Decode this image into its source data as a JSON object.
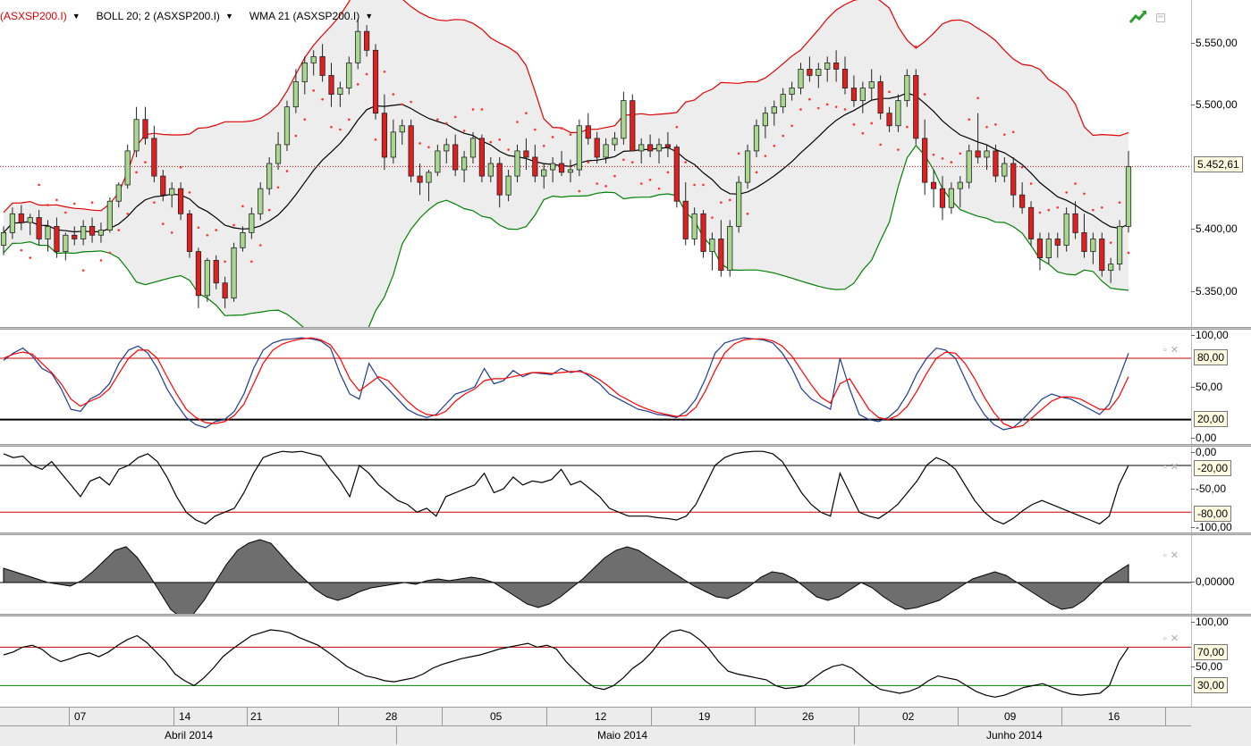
{
  "legend": {
    "symbol": "(ASXSP200.I)",
    "bollinger": "BOLL 20; 2 (ASXSP200.I)",
    "wma": "WMA 21 (ASXSP200.I)"
  },
  "colors": {
    "bull_candle": "#a8d890",
    "bear_candle": "#e02020",
    "upper_band": "#e00000",
    "lower_band": "#008000",
    "ma_line": "#000000",
    "sar_dots": "#ff3030",
    "stoch_k": "#1f3a8a",
    "stoch_d": "#ff0000",
    "level_line": "#cc0000",
    "histogram": "#6e6e6e"
  },
  "price_axis": {
    "ticks": [
      "5.550,00",
      "5.500,00",
      "5.452,61",
      "5.400,00",
      "5.350,00"
    ],
    "current_value": "5.452,61"
  },
  "stoch_axis": {
    "ticks": [
      "100,00",
      "80,00",
      "50,00",
      "20,00",
      "0,00"
    ],
    "highlight": [
      "80,00",
      "20,00"
    ]
  },
  "williams_axis": {
    "ticks": [
      "0,00",
      "-20,00",
      "-50,00",
      "-80,00",
      "-100,00"
    ],
    "highlight": [
      "-20,00",
      "-80,00"
    ]
  },
  "macd_axis": {
    "ticks": [
      "0,00000"
    ]
  },
  "rsi_axis": {
    "ticks": [
      "100,00",
      "70,00",
      "50,00",
      "30,00"
    ],
    "highlight": [
      "70,00",
      "30,00"
    ]
  },
  "time_axis": {
    "days": [
      "07",
      "14",
      "21",
      "28",
      "05",
      "12",
      "19",
      "26",
      "02",
      "09",
      "16"
    ],
    "months": [
      "Abril 2014",
      "Maio 2014",
      "Junho 2014"
    ]
  },
  "chart_data": {
    "type": "candlestick",
    "candles_ohlc": [
      [
        5390,
        5405,
        5382,
        5400
      ],
      [
        5400,
        5420,
        5395,
        5415
      ],
      [
        5415,
        5422,
        5402,
        5408
      ],
      [
        5408,
        5415,
        5398,
        5412
      ],
      [
        5412,
        5418,
        5390,
        5395
      ],
      [
        5395,
        5410,
        5385,
        5405
      ],
      [
        5405,
        5412,
        5380,
        5385
      ],
      [
        5385,
        5400,
        5378,
        5398
      ],
      [
        5398,
        5405,
        5390,
        5395
      ],
      [
        5395,
        5410,
        5390,
        5405
      ],
      [
        5405,
        5412,
        5392,
        5398
      ],
      [
        5398,
        5408,
        5392,
        5402
      ],
      [
        5402,
        5428,
        5400,
        5425
      ],
      [
        5425,
        5440,
        5420,
        5438
      ],
      [
        5438,
        5470,
        5435,
        5465
      ],
      [
        5465,
        5500,
        5460,
        5490
      ],
      [
        5490,
        5500,
        5470,
        5475
      ],
      [
        5475,
        5485,
        5440,
        5445
      ],
      [
        5445,
        5450,
        5425,
        5430
      ],
      [
        5430,
        5440,
        5420,
        5435
      ],
      [
        5435,
        5440,
        5410,
        5415
      ],
      [
        5415,
        5418,
        5380,
        5385
      ],
      [
        5385,
        5388,
        5340,
        5350
      ],
      [
        5350,
        5380,
        5345,
        5378
      ],
      [
        5378,
        5382,
        5355,
        5360
      ],
      [
        5360,
        5365,
        5340,
        5348
      ],
      [
        5348,
        5392,
        5345,
        5388
      ],
      [
        5388,
        5405,
        5385,
        5400
      ],
      [
        5400,
        5420,
        5395,
        5415
      ],
      [
        5415,
        5440,
        5410,
        5435
      ],
      [
        5435,
        5460,
        5430,
        5455
      ],
      [
        5455,
        5480,
        5450,
        5470
      ],
      [
        5470,
        5505,
        5465,
        5500
      ],
      [
        5500,
        5530,
        5495,
        5520
      ],
      [
        5520,
        5540,
        5510,
        5535
      ],
      [
        5535,
        5545,
        5525,
        5540
      ],
      [
        5540,
        5550,
        5520,
        5525
      ],
      [
        5525,
        5535,
        5500,
        5510
      ],
      [
        5510,
        5520,
        5500,
        5515
      ],
      [
        5515,
        5540,
        5510,
        5535
      ],
      [
        5535,
        5570,
        5530,
        5560
      ],
      [
        5560,
        5565,
        5540,
        5545
      ],
      [
        5545,
        5550,
        5490,
        5495
      ],
      [
        5495,
        5510,
        5450,
        5460
      ],
      [
        5460,
        5490,
        5455,
        5480
      ],
      [
        5480,
        5490,
        5470,
        5485
      ],
      [
        5485,
        5490,
        5440,
        5445
      ],
      [
        5445,
        5455,
        5430,
        5440
      ],
      [
        5440,
        5450,
        5425,
        5448
      ],
      [
        5448,
        5470,
        5445,
        5465
      ],
      [
        5465,
        5475,
        5455,
        5470
      ],
      [
        5470,
        5478,
        5445,
        5450
      ],
      [
        5450,
        5465,
        5440,
        5460
      ],
      [
        5460,
        5480,
        5455,
        5475
      ],
      [
        5475,
        5478,
        5440,
        5445
      ],
      [
        5445,
        5460,
        5440,
        5455
      ],
      [
        5455,
        5460,
        5420,
        5430
      ],
      [
        5430,
        5450,
        5425,
        5445
      ],
      [
        5445,
        5470,
        5440,
        5465
      ],
      [
        5465,
        5475,
        5450,
        5460
      ],
      [
        5460,
        5470,
        5440,
        5445
      ],
      [
        5445,
        5455,
        5435,
        5450
      ],
      [
        5450,
        5460,
        5440,
        5455
      ],
      [
        5455,
        5465,
        5445,
        5448
      ],
      [
        5448,
        5458,
        5440,
        5450
      ],
      [
        5450,
        5490,
        5445,
        5485
      ],
      [
        5485,
        5495,
        5470,
        5475
      ],
      [
        5475,
        5480,
        5455,
        5460
      ],
      [
        5460,
        5475,
        5455,
        5470
      ],
      [
        5470,
        5480,
        5465,
        5475
      ],
      [
        5475,
        5512,
        5470,
        5505
      ],
      [
        5505,
        5510,
        5470,
        5465
      ],
      [
        5465,
        5475,
        5455,
        5470
      ],
      [
        5470,
        5478,
        5460,
        5465
      ],
      [
        5465,
        5475,
        5455,
        5470
      ],
      [
        5470,
        5480,
        5460,
        5468
      ],
      [
        5468,
        5470,
        5420,
        5425
      ],
      [
        5425,
        5440,
        5390,
        5395
      ],
      [
        5395,
        5420,
        5390,
        5415
      ],
      [
        5415,
        5418,
        5380,
        5385
      ],
      [
        5385,
        5400,
        5370,
        5395
      ],
      [
        5395,
        5410,
        5365,
        5370
      ],
      [
        5370,
        5410,
        5365,
        5405
      ],
      [
        5405,
        5445,
        5400,
        5440
      ],
      [
        5440,
        5470,
        5435,
        5465
      ],
      [
        5465,
        5490,
        5460,
        5485
      ],
      [
        5485,
        5500,
        5475,
        5495
      ],
      [
        5495,
        5505,
        5485,
        5500
      ],
      [
        5500,
        5515,
        5495,
        5510
      ],
      [
        5510,
        5520,
        5505,
        5515
      ],
      [
        5515,
        5535,
        5510,
        5530
      ],
      [
        5530,
        5540,
        5520,
        5525
      ],
      [
        5525,
        5535,
        5515,
        5530
      ],
      [
        5530,
        5540,
        5520,
        5535
      ],
      [
        5535,
        5545,
        5520,
        5530
      ],
      [
        5530,
        5540,
        5510,
        5515
      ],
      [
        5515,
        5525,
        5500,
        5505
      ],
      [
        5505,
        5520,
        5495,
        5515
      ],
      [
        5515,
        5530,
        5505,
        5520
      ],
      [
        5520,
        5525,
        5490,
        5495
      ],
      [
        5495,
        5500,
        5480,
        5485
      ],
      [
        5485,
        5510,
        5480,
        5505
      ],
      [
        5505,
        5530,
        5500,
        5525
      ],
      [
        5525,
        5530,
        5470,
        5475
      ],
      [
        5475,
        5490,
        5430,
        5440
      ],
      [
        5440,
        5450,
        5420,
        5435
      ],
      [
        5435,
        5445,
        5410,
        5420
      ],
      [
        5420,
        5440,
        5415,
        5435
      ],
      [
        5435,
        5445,
        5420,
        5440
      ],
      [
        5440,
        5470,
        5435,
        5465
      ],
      [
        5465,
        5495,
        5455,
        5460
      ],
      [
        5460,
        5470,
        5450,
        5465
      ],
      [
        5465,
        5470,
        5440,
        5445
      ],
      [
        5445,
        5460,
        5440,
        5455
      ],
      [
        5455,
        5460,
        5420,
        5430
      ],
      [
        5430,
        5440,
        5415,
        5420
      ],
      [
        5420,
        5425,
        5390,
        5395
      ],
      [
        5395,
        5400,
        5370,
        5380
      ],
      [
        5380,
        5400,
        5375,
        5395
      ],
      [
        5395,
        5400,
        5380,
        5390
      ],
      [
        5390,
        5420,
        5385,
        5415
      ],
      [
        5415,
        5425,
        5395,
        5400
      ],
      [
        5400,
        5415,
        5380,
        5385
      ],
      [
        5385,
        5400,
        5375,
        5395
      ],
      [
        5395,
        5400,
        5365,
        5370
      ],
      [
        5370,
        5380,
        5360,
        5375
      ],
      [
        5375,
        5410,
        5370,
        5405
      ],
      [
        5405,
        5465,
        5400,
        5452.61
      ]
    ],
    "ylim": [
      5325,
      5585
    ],
    "stochastic_k": [
      78,
      85,
      90,
      82,
      70,
      65,
      50,
      30,
      28,
      40,
      45,
      55,
      75,
      88,
      92,
      85,
      70,
      50,
      35,
      22,
      15,
      12,
      18,
      20,
      28,
      45,
      70,
      88,
      95,
      98,
      99,
      100,
      99,
      97,
      90,
      65,
      45,
      40,
      75,
      60,
      50,
      40,
      30,
      25,
      22,
      25,
      35,
      45,
      48,
      52,
      70,
      55,
      58,
      68,
      62,
      66,
      65,
      64,
      70,
      66,
      68,
      62,
      55,
      45,
      40,
      35,
      30,
      28,
      25,
      24,
      22,
      28,
      40,
      60,
      85,
      95,
      98,
      100,
      99,
      98,
      95,
      85,
      70,
      50,
      40,
      35,
      30,
      80,
      50,
      25,
      20,
      18,
      22,
      30,
      45,
      65,
      80,
      90,
      88,
      80,
      60,
      40,
      25,
      15,
      10,
      12,
      20,
      30,
      40,
      45,
      42,
      40,
      35,
      30,
      25,
      35,
      60,
      85
    ],
    "stochastic_d": [
      80,
      84,
      86,
      84,
      75,
      66,
      55,
      40,
      33,
      38,
      42,
      50,
      65,
      80,
      88,
      88,
      80,
      62,
      45,
      30,
      22,
      17,
      16,
      18,
      24,
      35,
      55,
      75,
      88,
      94,
      97,
      99,
      100,
      98,
      93,
      80,
      60,
      48,
      55,
      62,
      58,
      48,
      38,
      30,
      25,
      24,
      28,
      38,
      45,
      50,
      58,
      60,
      60,
      62,
      64,
      66,
      66,
      65,
      66,
      67,
      67,
      64,
      59,
      52,
      44,
      39,
      34,
      30,
      27,
      25,
      23,
      24,
      32,
      48,
      68,
      85,
      94,
      98,
      99,
      99,
      97,
      92,
      82,
      68,
      54,
      42,
      36,
      55,
      60,
      45,
      30,
      22,
      20,
      24,
      33,
      48,
      65,
      80,
      86,
      85,
      75,
      60,
      42,
      27,
      16,
      12,
      14,
      22,
      30,
      38,
      42,
      42,
      40,
      35,
      30,
      30,
      42,
      62
    ],
    "williams_r": [
      -5,
      -10,
      -8,
      -20,
      -25,
      -15,
      -30,
      -45,
      -60,
      -40,
      -35,
      -45,
      -25,
      -20,
      -10,
      -5,
      -15,
      -35,
      -60,
      -80,
      -90,
      -95,
      -85,
      -80,
      -75,
      -55,
      -30,
      -10,
      -5,
      -2,
      -3,
      -2,
      -5,
      -8,
      -25,
      -40,
      -60,
      -20,
      -30,
      -45,
      -55,
      -65,
      -70,
      -80,
      -75,
      -85,
      -60,
      -55,
      -50,
      -45,
      -30,
      -55,
      -50,
      -35,
      -45,
      -40,
      -42,
      -38,
      -25,
      -45,
      -40,
      -50,
      -60,
      -75,
      -80,
      -85,
      -85,
      -85,
      -87,
      -88,
      -90,
      -85,
      -70,
      -45,
      -20,
      -10,
      -5,
      -3,
      -2,
      -2,
      -5,
      -15,
      -35,
      -55,
      -70,
      -80,
      -85,
      -30,
      -55,
      -80,
      -85,
      -88,
      -80,
      -70,
      -55,
      -40,
      -20,
      -10,
      -15,
      -25,
      -45,
      -65,
      -80,
      -90,
      -95,
      -88,
      -78,
      -70,
      -65,
      -70,
      -75,
      -80,
      -85,
      -90,
      -95,
      -85,
      -45,
      -20
    ],
    "macd_hist": [
      8,
      6,
      4,
      2,
      0,
      -1,
      -2,
      1,
      6,
      12,
      18,
      20,
      14,
      5,
      -5,
      -15,
      -20,
      -18,
      -10,
      0,
      10,
      18,
      22,
      24,
      22,
      15,
      8,
      2,
      -4,
      -8,
      -10,
      -8,
      -5,
      -3,
      -2,
      -1,
      0,
      -1,
      1,
      2,
      1,
      2,
      3,
      2,
      0,
      -4,
      -8,
      -12,
      -14,
      -12,
      -8,
      -3,
      2,
      8,
      14,
      18,
      20,
      18,
      14,
      10,
      6,
      2,
      -2,
      -5,
      -8,
      -9,
      -6,
      -2,
      3,
      6,
      5,
      2,
      -3,
      -8,
      -10,
      -8,
      -4,
      0,
      -3,
      -8,
      -12,
      -15,
      -14,
      -12,
      -10,
      -6,
      -2,
      2,
      4,
      6,
      4,
      0,
      -4,
      -8,
      -12,
      -15,
      -14,
      -10,
      -4,
      2,
      6,
      10
    ],
    "rsi": [
      62,
      65,
      70,
      72,
      68,
      60,
      55,
      58,
      62,
      64,
      60,
      65,
      72,
      78,
      82,
      75,
      65,
      55,
      42,
      35,
      30,
      38,
      48,
      60,
      68,
      75,
      82,
      85,
      88,
      87,
      85,
      80,
      76,
      72,
      65,
      58,
      50,
      45,
      40,
      38,
      35,
      34,
      36,
      38,
      42,
      48,
      52,
      55,
      58,
      60,
      62,
      65,
      68,
      70,
      72,
      74,
      70,
      72,
      68,
      55,
      45,
      35,
      28,
      26,
      30,
      38,
      48,
      55,
      65,
      78,
      86,
      88,
      85,
      78,
      68,
      55,
      45,
      42,
      40,
      38,
      36,
      30,
      27,
      28,
      30,
      38,
      45,
      50,
      52,
      48,
      40,
      32,
      26,
      24,
      22,
      24,
      28,
      35,
      40,
      38,
      36,
      30,
      24,
      20,
      18,
      20,
      24,
      28,
      30,
      32,
      28,
      24,
      21,
      20,
      21,
      22,
      30,
      55,
      70
    ]
  }
}
